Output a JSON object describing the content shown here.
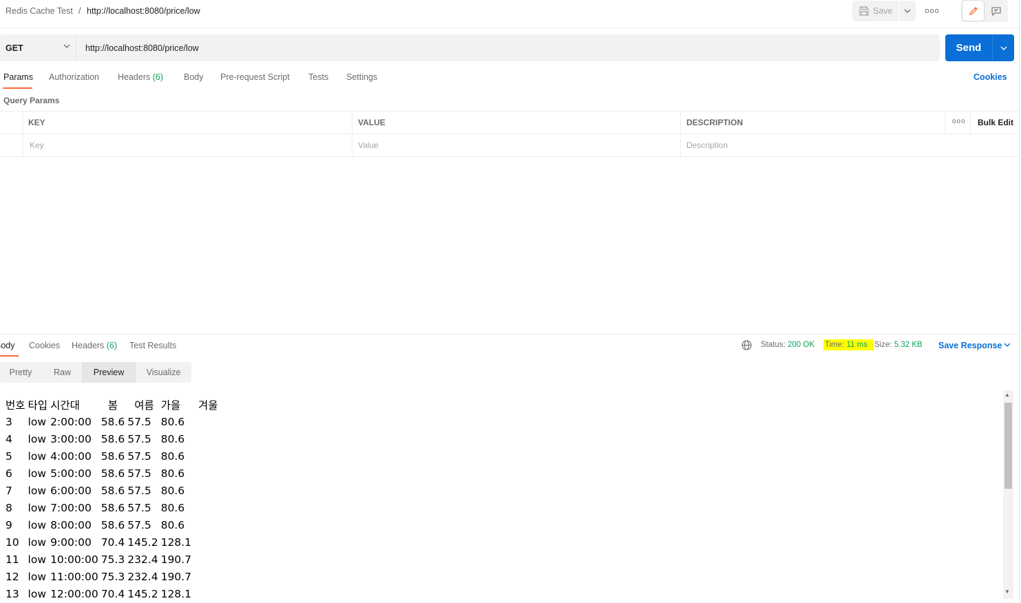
{
  "breadcrumb": {
    "parent": "Redis Cache Test",
    "separator": "/",
    "current": "http://localhost:8080/price/low"
  },
  "toolbar": {
    "save_label": "Save",
    "more_label": "ooo"
  },
  "request": {
    "method": "GET",
    "url": "http://localhost:8080/price/low",
    "send_label": "Send"
  },
  "request_tabs": [
    {
      "label": "Params",
      "count": ""
    },
    {
      "label": "Authorization",
      "count": ""
    },
    {
      "label": "Headers",
      "count": "(6)"
    },
    {
      "label": "Body",
      "count": ""
    },
    {
      "label": "Pre-request Script",
      "count": ""
    },
    {
      "label": "Tests",
      "count": ""
    },
    {
      "label": "Settings",
      "count": ""
    }
  ],
  "cookies_label": "Cookies",
  "query_params": {
    "title": "Query Params",
    "columns": [
      "KEY",
      "VALUE",
      "DESCRIPTION"
    ],
    "placeholders": {
      "key": "Key",
      "value": "Value",
      "description": "Description"
    },
    "more_label": "ooo",
    "bulk_edit_label": "Bulk Edit"
  },
  "response_tabs": [
    {
      "label": "Body",
      "count": ""
    },
    {
      "label": "Cookies",
      "count": ""
    },
    {
      "label": "Headers",
      "count": "(6)"
    },
    {
      "label": "Test Results",
      "count": ""
    }
  ],
  "response_status": {
    "status_label": "Status:",
    "status_value": "200 OK",
    "time_label": "Time:",
    "time_value": "11 ms",
    "size_label": "Size:",
    "size_value": "5.32 KB",
    "save_response_label": "Save Response"
  },
  "view_modes": [
    "Pretty",
    "Raw",
    "Preview",
    "Visualize"
  ],
  "preview_table": {
    "headers": [
      "번호",
      "타입",
      "시간대",
      "봄",
      "여름",
      "가을",
      "겨울"
    ],
    "rows": [
      [
        "3",
        "low",
        "2:00:00",
        "58.6",
        "57.5",
        "80.6",
        ""
      ],
      [
        "4",
        "low",
        "3:00:00",
        "58.6",
        "57.5",
        "80.6",
        ""
      ],
      [
        "5",
        "low",
        "4:00:00",
        "58.6",
        "57.5",
        "80.6",
        ""
      ],
      [
        "6",
        "low",
        "5:00:00",
        "58.6",
        "57.5",
        "80.6",
        ""
      ],
      [
        "7",
        "low",
        "6:00:00",
        "58.6",
        "57.5",
        "80.6",
        ""
      ],
      [
        "8",
        "low",
        "7:00:00",
        "58.6",
        "57.5",
        "80.6",
        ""
      ],
      [
        "9",
        "low",
        "8:00:00",
        "58.6",
        "57.5",
        "80.6",
        ""
      ],
      [
        "10",
        "low",
        "9:00:00",
        "70.4",
        "145.2",
        "128.1",
        ""
      ],
      [
        "11",
        "low",
        "10:00:00",
        "75.3",
        "232.4",
        "190.7",
        ""
      ],
      [
        "12",
        "low",
        "11:00:00",
        "75.3",
        "232.4",
        "190.7",
        ""
      ],
      [
        "13",
        "low",
        "12:00:00",
        "70.4",
        "145.2",
        "128.1",
        ""
      ]
    ]
  },
  "colors": {
    "accent": "#ff6c37",
    "primary": "#0a6fd6",
    "success": "#0ca45a",
    "highlight": "#ffff00"
  },
  "icons": {
    "save": "save-icon",
    "edit": "pencil-icon",
    "comment": "comment-icon",
    "globe": "globe-icon",
    "chevron": "chevron-down-icon"
  }
}
